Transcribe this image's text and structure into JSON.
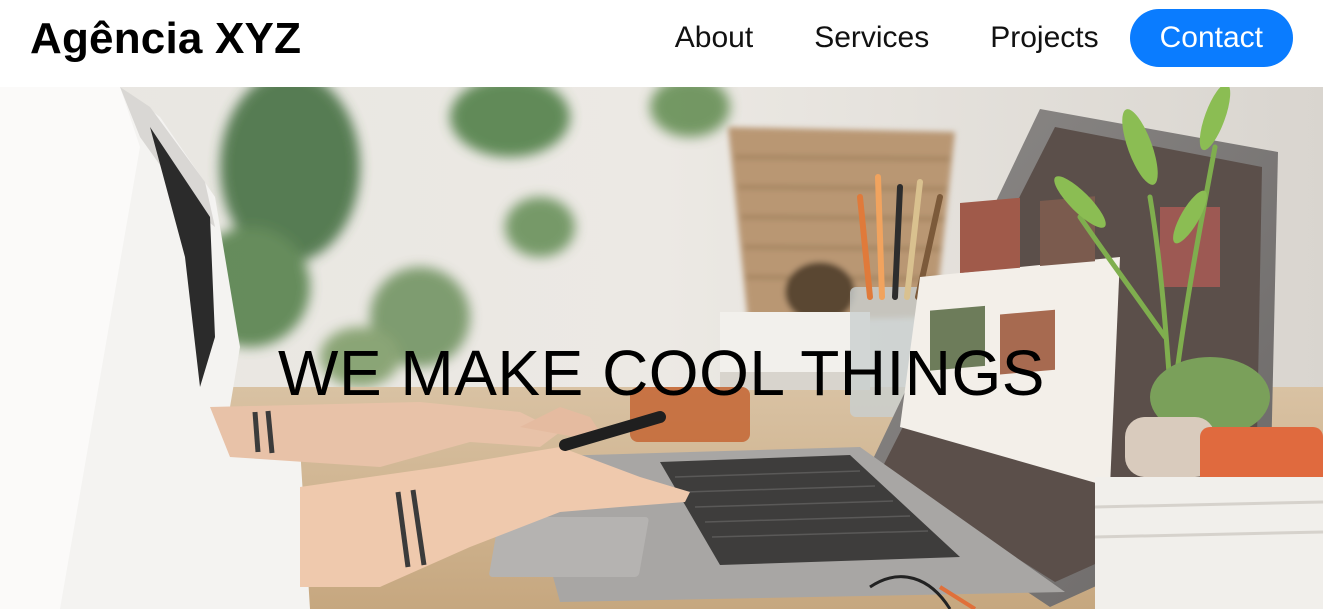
{
  "header": {
    "brand": "Agência XYZ",
    "nav": [
      {
        "label": "About"
      },
      {
        "label": "Services"
      },
      {
        "label": "Projects"
      }
    ],
    "cta_label": "Contact",
    "accent_color": "#0a7cff"
  },
  "hero": {
    "title": "WE MAKE COOL THINGS",
    "background_image": "woman-working-on-laptop-with-stylus-and-plants"
  }
}
